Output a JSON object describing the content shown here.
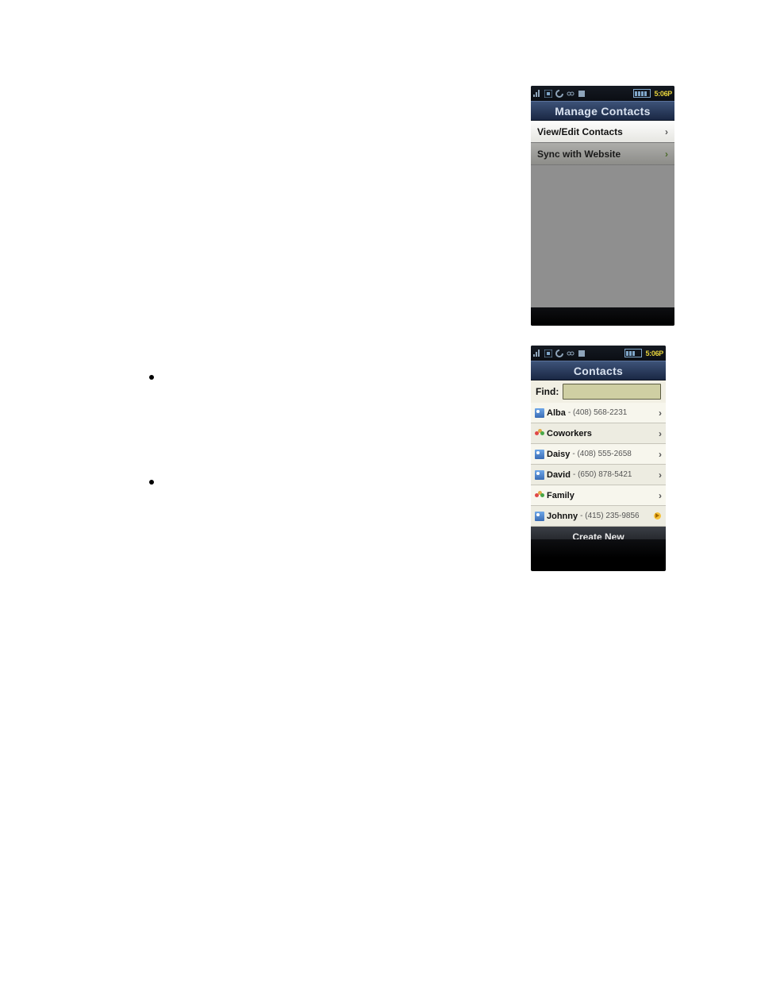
{
  "status": {
    "time": "5:06P"
  },
  "screen1": {
    "title": "Manage Contacts",
    "items": [
      {
        "label": "View/Edit Contacts"
      },
      {
        "label": "Sync with Website"
      }
    ]
  },
  "screen2": {
    "title": "Contacts",
    "find_label": "Find:",
    "rows": [
      {
        "type": "person",
        "name": "Alba",
        "phone": "- (408) 568-2231"
      },
      {
        "type": "group",
        "name": "Coworkers",
        "phone": ""
      },
      {
        "type": "person",
        "name": "Daisy",
        "phone": "- (408) 555-2658"
      },
      {
        "type": "person",
        "name": "David",
        "phone": "- (650) 878-5421"
      },
      {
        "type": "group",
        "name": "Family",
        "phone": ""
      },
      {
        "type": "person",
        "name": "Johnny",
        "phone": "- (415) 235-9856"
      }
    ],
    "create_label": "Create New"
  }
}
